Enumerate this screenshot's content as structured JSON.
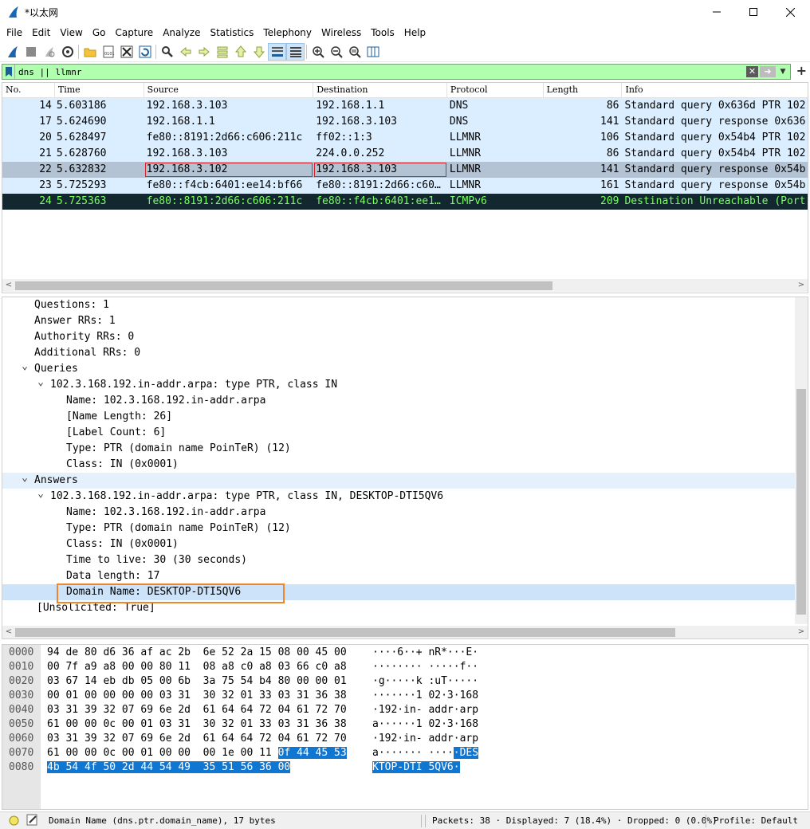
{
  "window": {
    "title": "*以太网"
  },
  "menu": [
    "File",
    "Edit",
    "View",
    "Go",
    "Capture",
    "Analyze",
    "Statistics",
    "Telephony",
    "Wireless",
    "Tools",
    "Help"
  ],
  "filter": {
    "value": "dns || llmnr"
  },
  "packet_list": {
    "columns": [
      "No.",
      "Time",
      "Source",
      "Destination",
      "Protocol",
      "Length",
      "Info"
    ],
    "rows": [
      {
        "no": "14",
        "time": "5.603186",
        "src": "192.168.3.103",
        "dst": "192.168.1.1",
        "proto": "DNS",
        "len": "86",
        "info": "Standard query 0x636d PTR 102",
        "style": "normal"
      },
      {
        "no": "17",
        "time": "5.624690",
        "src": "192.168.1.1",
        "dst": "192.168.3.103",
        "proto": "DNS",
        "len": "141",
        "info": "Standard query response 0x636",
        "style": "normal"
      },
      {
        "no": "20",
        "time": "5.628497",
        "src": "fe80::8191:2d66:c606:211c",
        "dst": "ff02::1:3",
        "proto": "LLMNR",
        "len": "106",
        "info": "Standard query 0x54b4 PTR 102",
        "style": "normal"
      },
      {
        "no": "21",
        "time": "5.628760",
        "src": "192.168.3.103",
        "dst": "224.0.0.252",
        "proto": "LLMNR",
        "len": "86",
        "info": "Standard query 0x54b4 PTR 102",
        "style": "normal"
      },
      {
        "no": "22",
        "time": "5.632832",
        "src": "192.168.3.102",
        "dst": "192.168.3.103",
        "proto": "LLMNR",
        "len": "141",
        "info": "Standard query response 0x54b",
        "style": "selected"
      },
      {
        "no": "23",
        "time": "5.725293",
        "src": "fe80::f4cb:6401:ee14:bf66",
        "dst": "fe80::8191:2d66:c60…",
        "proto": "LLMNR",
        "len": "161",
        "info": "Standard query response 0x54b",
        "style": "normal"
      },
      {
        "no": "24",
        "time": "5.725363",
        "src": "fe80::8191:2d66:c606:211c",
        "dst": "fe80::f4cb:6401:ee1…",
        "proto": "ICMPv6",
        "len": "209",
        "info": "Destination Unreachable (Port",
        "style": "error"
      }
    ]
  },
  "details": [
    {
      "text": "Questions: 1",
      "indent": 0,
      "twisty": ""
    },
    {
      "text": "Answer RRs: 1",
      "indent": 0,
      "twisty": ""
    },
    {
      "text": "Authority RRs: 0",
      "indent": 0,
      "twisty": ""
    },
    {
      "text": "Additional RRs: 0",
      "indent": 0,
      "twisty": ""
    },
    {
      "text": "Queries",
      "indent": 0,
      "twisty": "v"
    },
    {
      "text": "102.3.168.192.in-addr.arpa: type PTR, class IN",
      "indent": 1,
      "twisty": "v"
    },
    {
      "text": "Name: 102.3.168.192.in-addr.arpa",
      "indent": 2,
      "twisty": ""
    },
    {
      "text": "[Name Length: 26]",
      "indent": 2,
      "twisty": ""
    },
    {
      "text": "[Label Count: 6]",
      "indent": 2,
      "twisty": ""
    },
    {
      "text": "Type: PTR (domain name PoinTeR) (12)",
      "indent": 2,
      "twisty": ""
    },
    {
      "text": "Class: IN (0x0001)",
      "indent": 2,
      "twisty": ""
    },
    {
      "text": "Answers",
      "indent": 0,
      "twisty": "v",
      "hover": true
    },
    {
      "text": "102.3.168.192.in-addr.arpa: type PTR, class IN, DESKTOP-DTI5QV6",
      "indent": 1,
      "twisty": "v"
    },
    {
      "text": "Name: 102.3.168.192.in-addr.arpa",
      "indent": 2,
      "twisty": ""
    },
    {
      "text": "Type: PTR (domain name PoinTeR) (12)",
      "indent": 2,
      "twisty": ""
    },
    {
      "text": "Class: IN (0x0001)",
      "indent": 2,
      "twisty": ""
    },
    {
      "text": "Time to live: 30 (30 seconds)",
      "indent": 2,
      "twisty": ""
    },
    {
      "text": "Data length: 17",
      "indent": 2,
      "twisty": ""
    },
    {
      "text": "Domain Name: DESKTOP-DTI5QV6",
      "indent": 2,
      "twisty": "",
      "selected": true
    },
    {
      "text": "[Unsolicited: True]",
      "indent": -1,
      "twisty": ""
    }
  ],
  "bytes": [
    {
      "off": "0000",
      "hex": "94 de 80 d6 36 af ac 2b  6e 52 2a 15 08 00 45 00",
      "asc": "····6··+ nR*···E·"
    },
    {
      "off": "0010",
      "hex": "00 7f a9 a8 00 00 80 11  08 a8 c0 a8 03 66 c0 a8",
      "asc": "········ ·····f··"
    },
    {
      "off": "0020",
      "hex": "03 67 14 eb db 05 00 6b  3a 75 54 b4 80 00 00 01",
      "asc": "·g·····k :uT·····"
    },
    {
      "off": "0030",
      "hex": "00 01 00 00 00 00 03 31  30 32 01 33 03 31 36 38",
      "asc": "·······1 02·3·168"
    },
    {
      "off": "0040",
      "hex": "03 31 39 32 07 69 6e 2d  61 64 64 72 04 61 72 70",
      "asc": "·192·in- addr·arp"
    },
    {
      "off": "0050",
      "hex": "61 00 00 0c 00 01 03 31  30 32 01 33 03 31 36 38",
      "asc": "a······1 02·3·168"
    },
    {
      "off": "0060",
      "hex": "03 31 39 32 07 69 6e 2d  61 64 64 72 04 61 72 70",
      "asc": "·192·in- addr·arp"
    },
    {
      "off": "0070",
      "hex_plain": "61 00 00 0c 00 01 00 00  00 1e 00 11 ",
      "hex_sel": "0f 44 45 53",
      "asc_plain": "a······· ····",
      "asc_sel": "·DES"
    },
    {
      "off": "0080",
      "hex_plain": "",
      "hex_sel": "4b 54 4f 50 2d 44 54 49  35 51 56 36 00",
      "asc_plain": "",
      "asc_sel": "KTOP-DTI 5QV6·"
    }
  ],
  "status": {
    "field": "Domain Name (dns.ptr.domain_name), 17 bytes",
    "packets": "Packets: 38 · Displayed: 7 (18.4%) · Dropped: 0 (0.0%)",
    "profile": "Profile: Default"
  }
}
